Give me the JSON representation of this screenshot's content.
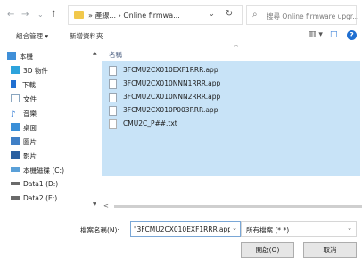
{
  "nav": {
    "back": "←",
    "forward": "→",
    "dropdown": "⌄",
    "up": "↑"
  },
  "address": {
    "path": "» 產線... › Online firmwa...",
    "dropdown": "⌄",
    "refresh": "↻"
  },
  "search": {
    "placeholder": "搜尋 Online firmware upgr..."
  },
  "toolbar": {
    "organize": "組合管理 ▾",
    "new_folder": "新增資料夾",
    "view": "▥ ▾",
    "pane": "□",
    "help": "?"
  },
  "sidebar": {
    "items": [
      {
        "label": "本機",
        "icon": "computer-icon",
        "color": "#3f8fd8"
      },
      {
        "label": "3D 物件",
        "icon": "cube-icon",
        "color": "#2ea3dc"
      },
      {
        "label": "下載",
        "icon": "download-icon",
        "color": "#1f6fd1"
      },
      {
        "label": "文件",
        "icon": "document-icon",
        "color": "#8aa6c0"
      },
      {
        "label": "音樂",
        "icon": "music-icon",
        "color": "#1f6fd1"
      },
      {
        "label": "桌面",
        "icon": "desktop-icon",
        "color": "#3a8fd8"
      },
      {
        "label": "圖片",
        "icon": "pictures-icon",
        "color": "#3f7fc6"
      },
      {
        "label": "影片",
        "icon": "videos-icon",
        "color": "#2a5fa0"
      },
      {
        "label": "本機磁碟 (C:)",
        "icon": "drive-icon",
        "color": "#5aa0d8"
      },
      {
        "label": "Data1 (D:)",
        "icon": "drive-icon",
        "color": "#6a6a6a"
      },
      {
        "label": "Data2 (E:)",
        "icon": "drive-icon",
        "color": "#6a6a6a"
      }
    ]
  },
  "files": {
    "column_name": "名稱",
    "items": [
      {
        "name": "3FCMU2CX010EXF1RRR.app"
      },
      {
        "name": "3FCMU2CX010NNN1RRR.app"
      },
      {
        "name": "3FCMU2CX010NNN2RRR.app"
      },
      {
        "name": "3FCMU2CX010P003RRR.app"
      },
      {
        "name": "CMU2C_P##.txt"
      }
    ]
  },
  "bottom": {
    "filename_label": "檔案名稱(N):",
    "filename_value": "\"3FCMU2CX010EXF1RRR.app\"",
    "filter_value": "所有檔案 (*.*)",
    "open_label": "開啟(O)",
    "cancel_label": "取消"
  },
  "colors": {
    "selection": "#c8e3f7",
    "accent": "#1f6fd1"
  }
}
